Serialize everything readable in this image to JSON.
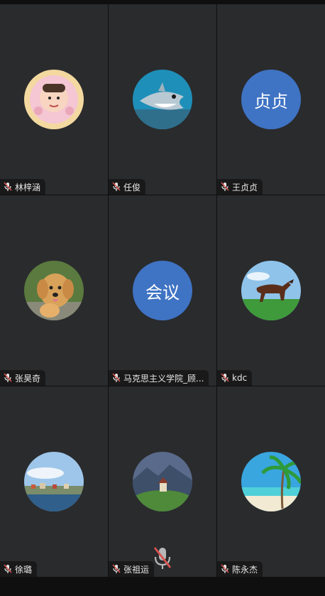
{
  "participants": [
    {
      "name": "林梓涵",
      "avatar": "cartoon-girl-avatar"
    },
    {
      "name": "任俊",
      "avatar": "shark-avatar"
    },
    {
      "name": "王贞贞",
      "avatar_text": "贞贞"
    },
    {
      "name": "张昊奇",
      "avatar": "dog-avatar"
    },
    {
      "name": "马克思主义学院_顾...",
      "avatar_text": "会议"
    },
    {
      "name": "kdc",
      "avatar": "horse-avatar"
    },
    {
      "name": "徐璐",
      "avatar": "lakeside-town-avatar"
    },
    {
      "name": "张祖运",
      "avatar": "hill-church-avatar"
    },
    {
      "name": "陈永杰",
      "avatar": "palm-beach-avatar"
    }
  ],
  "colors": {
    "tile_bg": "#2a2b2d",
    "text_avatar_bg": "#3f73c4",
    "muted_mic": "#d9534f"
  },
  "floating_control": {
    "icon": "mic-muted-icon"
  }
}
